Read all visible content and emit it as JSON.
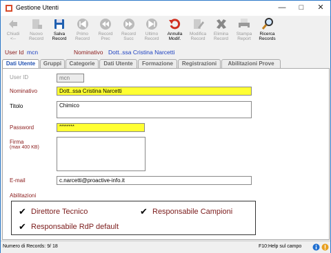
{
  "window": {
    "title": "Gestione Utenti"
  },
  "toolbar": [
    {
      "l1": "Chiudi",
      "l2": "<--",
      "icon": "arrow-left-icon",
      "enabled": false
    },
    {
      "l1": "Nuovo",
      "l2": "Record",
      "icon": "new-record-icon",
      "enabled": false
    },
    {
      "l1": "Salva",
      "l2": "Record",
      "icon": "save-icon",
      "enabled": true
    },
    {
      "l1": "Primo",
      "l2": "Record",
      "icon": "first-record-icon",
      "enabled": false
    },
    {
      "l1": "Record",
      "l2": "Prec",
      "icon": "prev-record-icon",
      "enabled": false
    },
    {
      "l1": "Record",
      "l2": "Succ",
      "icon": "next-record-icon",
      "enabled": false
    },
    {
      "l1": "Ultimo",
      "l2": "Record",
      "icon": "last-record-icon",
      "enabled": false
    },
    {
      "l1": "Annulla",
      "l2": "Modif.",
      "icon": "undo-icon",
      "enabled": true
    },
    {
      "l1": "Modifica",
      "l2": "Record",
      "icon": "edit-record-icon",
      "enabled": false
    },
    {
      "l1": "Elimina",
      "l2": "Record",
      "icon": "delete-icon",
      "enabled": false
    },
    {
      "l1": "Stampa",
      "l2": "Report",
      "icon": "print-icon",
      "enabled": false
    },
    {
      "l1": "Ricerca",
      "l2": "Records",
      "icon": "search-icon",
      "enabled": true
    }
  ],
  "header": {
    "userid_label": "User Id",
    "userid_value": "mcn",
    "nominativo_label": "Nominativo",
    "nominativo_value": "Dott..ssa Cristina Narcetti"
  },
  "tabs": [
    "Dati Utente",
    "Gruppi",
    "Categorie",
    "Dati Utente",
    "Formazione",
    "Registrazioni",
    "Abilitazioni Prove"
  ],
  "form": {
    "userid_label": "User ID",
    "userid_value": "mcn",
    "nominativo_label": "Nominativo",
    "nominativo_value": "Dott..ssa Cristina Narcetti",
    "titolo_label": "Titolo",
    "titolo_value": "Chimico",
    "password_label": "Password",
    "password_value": "********",
    "firma_label": "Firma",
    "firma_sub": "(max 400 KB)",
    "email_label": "E-mail",
    "email_value": "c.narcetti@proactive-info.it",
    "abilitazioni_label": "Abilitazioni",
    "chk1": "Direttore Tecnico",
    "chk2": "Responsabile Campioni",
    "chk3": "Responsabile RdP default"
  },
  "status": {
    "left": "Numero di Records: 9/ 18",
    "right": "F10:Help sul campo"
  }
}
